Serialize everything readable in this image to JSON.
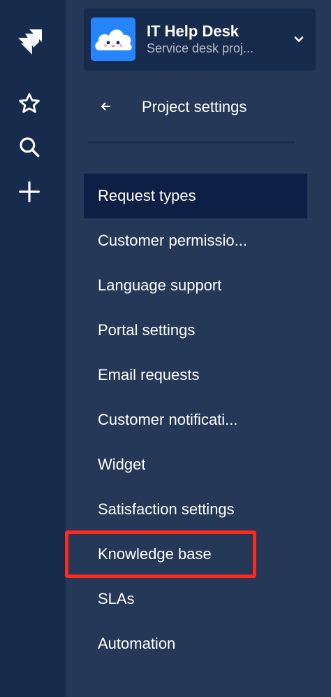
{
  "global_nav": {
    "icons": [
      "jira-logo-icon",
      "star-icon",
      "search-icon",
      "plus-icon"
    ]
  },
  "project": {
    "name": "IT Help Desk",
    "type": "Service desk proj..."
  },
  "settings": {
    "title": "Project settings"
  },
  "menu": {
    "items": [
      {
        "label": "Request types",
        "selected": true
      },
      {
        "label": "Customer permissio...",
        "selected": false
      },
      {
        "label": "Language support",
        "selected": false
      },
      {
        "label": "Portal settings",
        "selected": false
      },
      {
        "label": "Email requests",
        "selected": false
      },
      {
        "label": "Customer notificati...",
        "selected": false
      },
      {
        "label": "Widget",
        "selected": false
      },
      {
        "label": "Satisfaction settings",
        "selected": false
      },
      {
        "label": "Knowledge base",
        "selected": false,
        "highlighted": true
      },
      {
        "label": "SLAs",
        "selected": false
      },
      {
        "label": "Automation",
        "selected": false
      }
    ]
  },
  "colors": {
    "global_nav_bg": "#172b4d",
    "sidebar_bg": "#253858",
    "selected_bg": "#0d1f45",
    "highlight": "#ff2a1c",
    "avatar_bg": "#2684ff"
  }
}
